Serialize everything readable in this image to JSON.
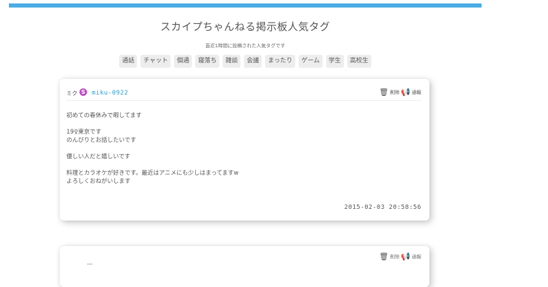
{
  "header": {
    "title": "スカイプちゃんねる掲示板人気タグ",
    "tags_caption": "直近1時間に投稿された人気タグです"
  },
  "tags": [
    "通話",
    "チャット",
    "個通",
    "寝落ち",
    "雑談",
    "会議",
    "まったり",
    "ゲーム",
    "学生",
    "高校生"
  ],
  "posts": [
    {
      "name": "ミク",
      "skype_id": "miku-0922",
      "delete_label": "削除",
      "report_label": "通報",
      "body": "初めての春休みで暇してます\n\n19♀東京です\nのんびりとお話したいです\n\n優しい人だと嬉しいです\n\n料理とカラオケが好きです。最近はアニメにも少しはまってますw\nよろしくおねがいします",
      "date": "2015-02-03 20:58:56"
    },
    {
      "delete_label": "削除",
      "report_label": "通報"
    }
  ],
  "colors": {
    "accent": "#4aade3",
    "skype": "#c04bc4",
    "link": "#2a9fd6"
  },
  "icons": {
    "skype": "skype-icon",
    "delete": "trash-icon",
    "report": "megaphone-icon"
  }
}
